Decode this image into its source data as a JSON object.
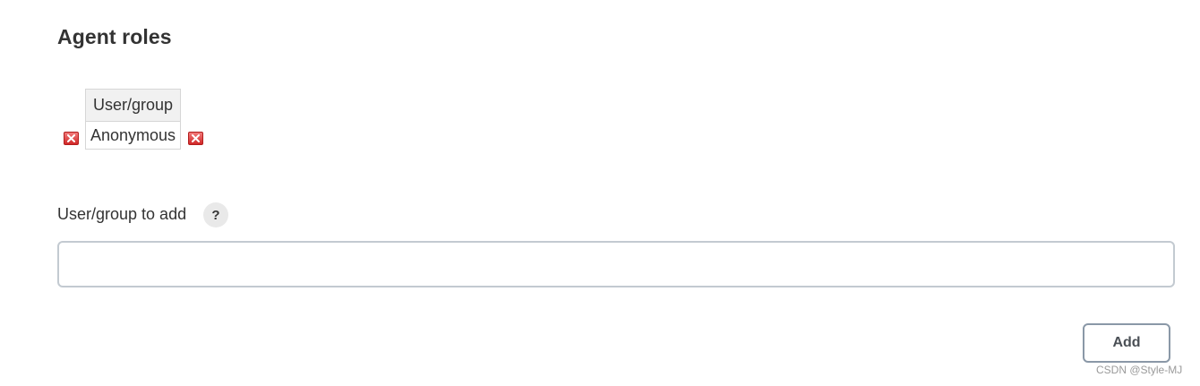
{
  "section": {
    "title": "Agent roles"
  },
  "roles_table": {
    "headers": [
      "User/group"
    ],
    "rows": [
      {
        "user_group": "Anonymous"
      }
    ]
  },
  "add_user": {
    "label": "User/group to add",
    "help_label": "?",
    "input_value": "",
    "input_placeholder": "",
    "button_label": "Add"
  },
  "icons": {
    "remove": "remove-icon",
    "help": "help-icon"
  },
  "watermark": "CSDN @Style-MJ",
  "colors": {
    "remove_red": "#d12828",
    "input_border": "#c3cad1",
    "button_border": "#8a98a7"
  }
}
